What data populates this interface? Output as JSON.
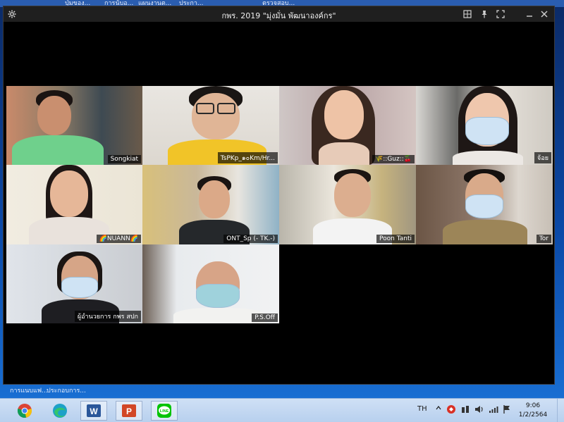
{
  "desktop": {
    "top_labels": [
      "ปุ่มของ...",
      "การนับอ...",
      "แผนงานต...",
      "ประกา...",
      "ตรวจสอบ..."
    ],
    "bottom_labels": [
      "การแนบแฟ...",
      "ประกอบการ..."
    ]
  },
  "window": {
    "title": "กพร. 2019 \"มุ่งมั่น พัฒนาองค์กร\"",
    "icons": {
      "settings": "gear-icon",
      "gallery": "gallery-view-icon",
      "pin": "pin-icon",
      "fullscreen": "fullscreen-icon",
      "minimize": "minimize-icon",
      "close": "close-icon"
    }
  },
  "participants": [
    {
      "name": "Songkiat"
    },
    {
      "name": "TsPKp_๑๐Km/Hr..."
    },
    {
      "name": "🌾::Guz::🍒"
    },
    {
      "name": "จ้อย"
    },
    {
      "name": "🌈NUANN🌈"
    },
    {
      "name": "ONT_Sp (- TK.-)"
    },
    {
      "name": "Poon Tanti"
    },
    {
      "name": "Tor"
    },
    {
      "name": "ผู้อำนวยการ กพร สปก"
    },
    {
      "name": "P.S.Off"
    }
  ],
  "taskbar": {
    "apps": [
      "chrome-icon",
      "edge-icon",
      "word-icon",
      "powerpoint-icon",
      "line-icon"
    ],
    "word_letter": "W",
    "ppt_letter": "P",
    "line_text": "LINE",
    "language": "TH",
    "time": "9:06",
    "date": "1/2/2564"
  },
  "colors": {
    "zoom_bg": "#000000",
    "titlebar": "#1f1f1f",
    "taskbar": "#cfe0f5",
    "desktop": "#0b4aa8"
  }
}
